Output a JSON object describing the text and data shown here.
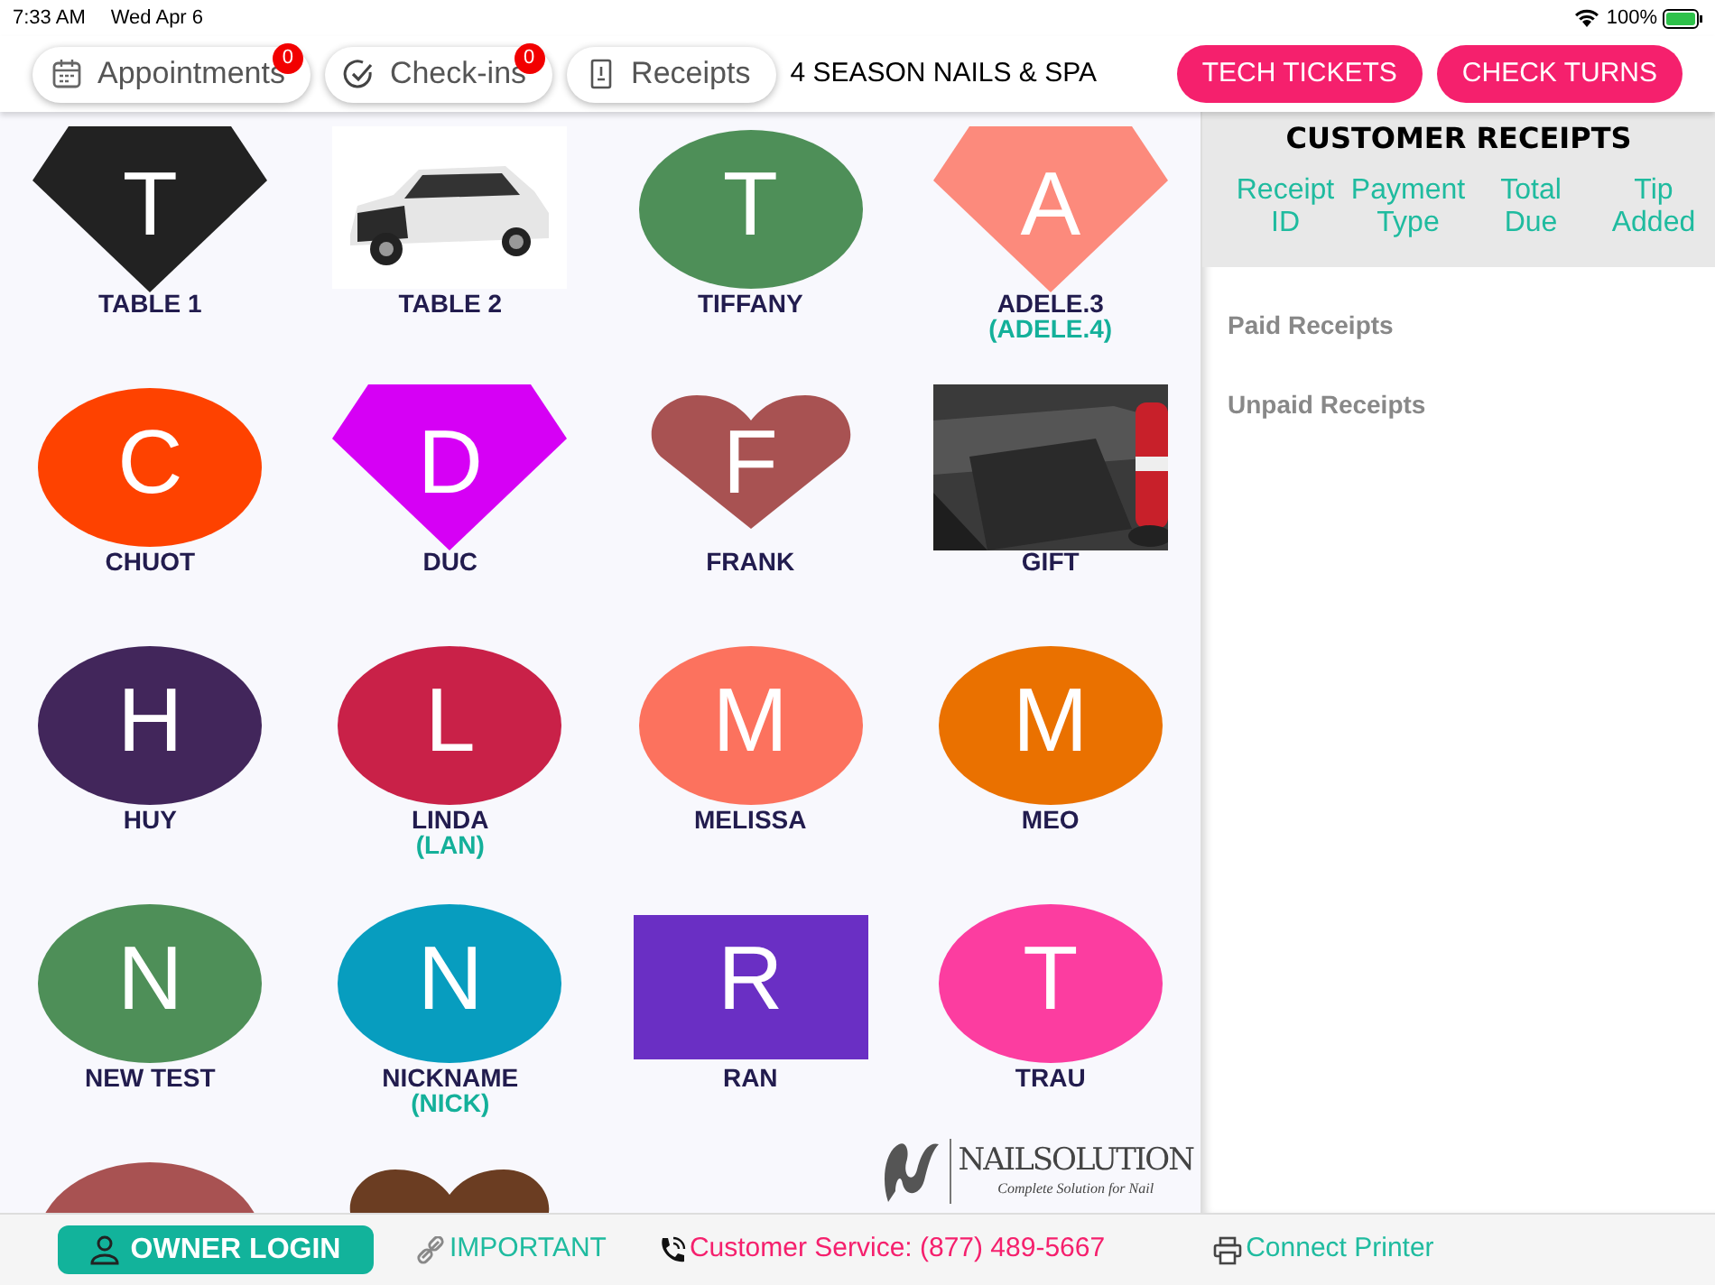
{
  "status_bar": {
    "time": "7:33 AM",
    "date": "Wed Apr 6",
    "battery": "100%"
  },
  "header": {
    "tabs": [
      {
        "label": "Appointments",
        "badge": "0"
      },
      {
        "label": "Check-ins",
        "badge": "0"
      },
      {
        "label": "Receipts"
      }
    ],
    "salon_name": "4 SEASON NAILS & SPA",
    "buttons": [
      "TECH TICKETS",
      "CHECK TURNS"
    ]
  },
  "tiles": [
    {
      "kind": "diamond",
      "color": "#222222",
      "letter": "T",
      "name": "TABLE 1"
    },
    {
      "kind": "picture",
      "name": "TABLE 2"
    },
    {
      "kind": "ellipse",
      "color": "#4e8f58",
      "letter": "T",
      "name": "TIFFANY"
    },
    {
      "kind": "diamond",
      "color": "#fc8a7c",
      "letter": "A",
      "name": "ADELE.3",
      "nickname": "(ADELE.4)"
    },
    {
      "kind": "ellipse",
      "color": "#fe4200",
      "letter": "C",
      "name": "CHUOT"
    },
    {
      "kind": "diamond",
      "color": "#d600f5",
      "letter": "D",
      "name": "DUC"
    },
    {
      "kind": "heart",
      "color": "#a85252",
      "letter": "F",
      "name": "FRANK"
    },
    {
      "kind": "picture",
      "name": "GIFT"
    },
    {
      "kind": "ellipse",
      "color": "#42265b",
      "letter": "H",
      "name": "HUY"
    },
    {
      "kind": "ellipse",
      "color": "#c92148",
      "letter": "L",
      "name": "LINDA",
      "nickname": "(LAN)"
    },
    {
      "kind": "ellipse",
      "color": "#fc725e",
      "letter": "M",
      "name": "MELISSA"
    },
    {
      "kind": "ellipse",
      "color": "#ea7100",
      "letter": "M",
      "name": "MEO"
    },
    {
      "kind": "ellipse",
      "color": "#4e8f58",
      "letter": "N",
      "name": "NEW TEST"
    },
    {
      "kind": "ellipse",
      "color": "#079dbf",
      "letter": "N",
      "name": "NICKNAME",
      "nickname": "(NICK)"
    },
    {
      "kind": "square",
      "color": "#6a2fc4",
      "letter": "R",
      "name": "RAN"
    },
    {
      "kind": "ellipse",
      "color": "#fc3da0",
      "letter": "T",
      "name": "TRAU"
    },
    {
      "kind": "ellipse",
      "color": "#a85252"
    },
    {
      "kind": "heart",
      "color": "#6b3d22"
    }
  ],
  "logo": {
    "title": "NAILSOLUTION",
    "tagline": "Complete Solution for Nail"
  },
  "receipts_panel": {
    "title": "CUSTOMER RECEIPTS",
    "columns": [
      "Receipt ID",
      "Payment Type",
      "Total Due",
      "Tip Added"
    ],
    "sections": [
      "Paid Receipts",
      "Unpaid Receipts"
    ]
  },
  "footer": {
    "owner_login": "OWNER LOGIN",
    "links": [
      {
        "kind": "link",
        "label": "IMPORTANT"
      },
      {
        "kind": "phone",
        "label": "Customer Service: (877) 489-5667"
      },
      {
        "kind": "printer",
        "label": "Connect Printer"
      }
    ]
  }
}
